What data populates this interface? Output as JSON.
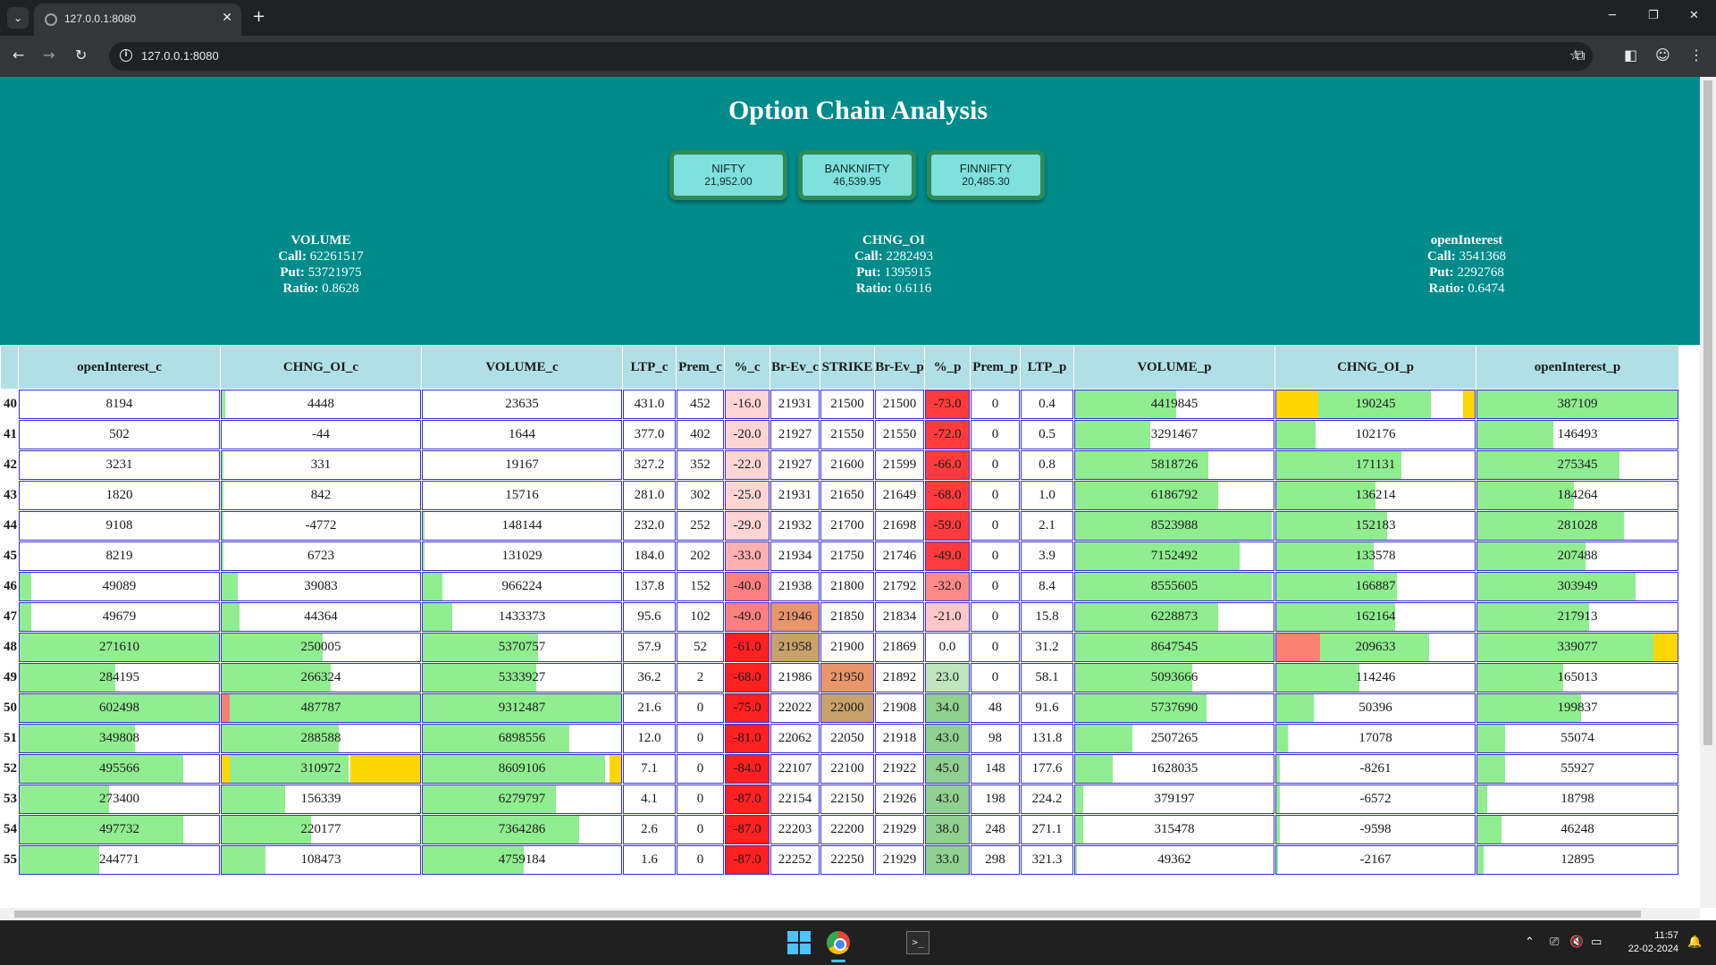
{
  "browser": {
    "tab_title": "127.0.0.1:8080",
    "url": "127.0.0.1:8080",
    "new_tab": "+",
    "close": "✕"
  },
  "page": {
    "title": "Option Chain Analysis",
    "indices": [
      {
        "name": "NIFTY",
        "price": "21,952.00"
      },
      {
        "name": "BANKNIFTY",
        "price": "46,539.95"
      },
      {
        "name": "FINNIFTY",
        "price": "20,485.30"
      }
    ],
    "stats": [
      {
        "heading": "VOLUME",
        "call_label": "Call:",
        "call": "62261517",
        "put_label": "Put:",
        "put": "53721975",
        "ratio_label": "Ratio:",
        "ratio": "0.8628"
      },
      {
        "heading": "CHNG_OI",
        "call_label": "Call:",
        "call": "2282493",
        "put_label": "Put:",
        "put": "1395915",
        "ratio_label": "Ratio:",
        "ratio": "0.6116"
      },
      {
        "heading": "openInterest",
        "call_label": "Call:",
        "call": "3541368",
        "put_label": "Put:",
        "put": "2292768",
        "ratio_label": "Ratio:",
        "ratio": "0.6474"
      }
    ]
  },
  "table": {
    "columns": [
      "openInterest_c",
      "CHNG_OI_c",
      "VOLUME_c",
      "LTP_c",
      "Prem_c",
      "%_c",
      "Br-Ev_c",
      "STRIKE",
      "Br-Ev_p",
      "%_p",
      "Prem_p",
      "LTP_p",
      "VOLUME_p",
      "CHNG_OI_p",
      "openInterest_p"
    ],
    "rows": [
      {
        "n": "40",
        "oi_c": "8194",
        "chg_c": "4448",
        "vol_c": "23635",
        "ltp_c": "431.0",
        "prem_c": "452",
        "pct_c": "-16.0",
        "be_c": "21931",
        "strike": "21500",
        "be_p": "21500",
        "pct_p": "-73.0",
        "prem_p": "0",
        "ltp_p": "0.4",
        "vol_p": "4419845",
        "chg_p": "190245",
        "oi_p": "387109"
      },
      {
        "n": "41",
        "oi_c": "502",
        "chg_c": "-44",
        "vol_c": "1644",
        "ltp_c": "377.0",
        "prem_c": "402",
        "pct_c": "-20.0",
        "be_c": "21927",
        "strike": "21550",
        "be_p": "21550",
        "pct_p": "-72.0",
        "prem_p": "0",
        "ltp_p": "0.5",
        "vol_p": "3291467",
        "chg_p": "102176",
        "oi_p": "146493"
      },
      {
        "n": "42",
        "oi_c": "3231",
        "chg_c": "331",
        "vol_c": "19167",
        "ltp_c": "327.2",
        "prem_c": "352",
        "pct_c": "-22.0",
        "be_c": "21927",
        "strike": "21600",
        "be_p": "21599",
        "pct_p": "-66.0",
        "prem_p": "0",
        "ltp_p": "0.8",
        "vol_p": "5818726",
        "chg_p": "171131",
        "oi_p": "275345"
      },
      {
        "n": "43",
        "oi_c": "1820",
        "chg_c": "842",
        "vol_c": "15716",
        "ltp_c": "281.0",
        "prem_c": "302",
        "pct_c": "-25.0",
        "be_c": "21931",
        "strike": "21650",
        "be_p": "21649",
        "pct_p": "-68.0",
        "prem_p": "0",
        "ltp_p": "1.0",
        "vol_p": "6186792",
        "chg_p": "136214",
        "oi_p": "184264"
      },
      {
        "n": "44",
        "oi_c": "9108",
        "chg_c": "-4772",
        "vol_c": "148144",
        "ltp_c": "232.0",
        "prem_c": "252",
        "pct_c": "-29.0",
        "be_c": "21932",
        "strike": "21700",
        "be_p": "21698",
        "pct_p": "-59.0",
        "prem_p": "0",
        "ltp_p": "2.1",
        "vol_p": "8523988",
        "chg_p": "152183",
        "oi_p": "281028"
      },
      {
        "n": "45",
        "oi_c": "8219",
        "chg_c": "6723",
        "vol_c": "131029",
        "ltp_c": "184.0",
        "prem_c": "202",
        "pct_c": "-33.0",
        "be_c": "21934",
        "strike": "21750",
        "be_p": "21746",
        "pct_p": "-49.0",
        "prem_p": "0",
        "ltp_p": "3.9",
        "vol_p": "7152492",
        "chg_p": "133578",
        "oi_p": "207488"
      },
      {
        "n": "46",
        "oi_c": "49089",
        "chg_c": "39083",
        "vol_c": "966224",
        "ltp_c": "137.8",
        "prem_c": "152",
        "pct_c": "-40.0",
        "be_c": "21938",
        "strike": "21800",
        "be_p": "21792",
        "pct_p": "-32.0",
        "prem_p": "0",
        "ltp_p": "8.4",
        "vol_p": "8555605",
        "chg_p": "166887",
        "oi_p": "303949"
      },
      {
        "n": "47",
        "oi_c": "49679",
        "chg_c": "44364",
        "vol_c": "1433373",
        "ltp_c": "95.6",
        "prem_c": "102",
        "pct_c": "-49.0",
        "be_c": "21946",
        "strike": "21850",
        "be_p": "21834",
        "pct_p": "-21.0",
        "prem_p": "0",
        "ltp_p": "15.8",
        "vol_p": "6228873",
        "chg_p": "162164",
        "oi_p": "217913"
      },
      {
        "n": "48",
        "oi_c": "271610",
        "chg_c": "250005",
        "vol_c": "5370757",
        "ltp_c": "57.9",
        "prem_c": "52",
        "pct_c": "-61.0",
        "be_c": "21958",
        "strike": "21900",
        "be_p": "21869",
        "pct_p": "0.0",
        "prem_p": "0",
        "ltp_p": "31.2",
        "vol_p": "8647545",
        "chg_p": "209633",
        "oi_p": "339077"
      },
      {
        "n": "49",
        "oi_c": "284195",
        "chg_c": "266324",
        "vol_c": "5333927",
        "ltp_c": "36.2",
        "prem_c": "2",
        "pct_c": "-68.0",
        "be_c": "21986",
        "strike": "21950",
        "be_p": "21892",
        "pct_p": "23.0",
        "prem_p": "0",
        "ltp_p": "58.1",
        "vol_p": "5093666",
        "chg_p": "114246",
        "oi_p": "165013"
      },
      {
        "n": "50",
        "oi_c": "602498",
        "chg_c": "487787",
        "vol_c": "9312487",
        "ltp_c": "21.6",
        "prem_c": "0",
        "pct_c": "-75.0",
        "be_c": "22022",
        "strike": "22000",
        "be_p": "21908",
        "pct_p": "34.0",
        "prem_p": "48",
        "ltp_p": "91.6",
        "vol_p": "5737690",
        "chg_p": "50396",
        "oi_p": "199837"
      },
      {
        "n": "51",
        "oi_c": "349808",
        "chg_c": "288588",
        "vol_c": "6898556",
        "ltp_c": "12.0",
        "prem_c": "0",
        "pct_c": "-81.0",
        "be_c": "22062",
        "strike": "22050",
        "be_p": "21918",
        "pct_p": "43.0",
        "prem_p": "98",
        "ltp_p": "131.8",
        "vol_p": "2507265",
        "chg_p": "17078",
        "oi_p": "55074"
      },
      {
        "n": "52",
        "oi_c": "495566",
        "chg_c": "310972",
        "vol_c": "8609106",
        "ltp_c": "7.1",
        "prem_c": "0",
        "pct_c": "-84.0",
        "be_c": "22107",
        "strike": "22100",
        "be_p": "21922",
        "pct_p": "45.0",
        "prem_p": "148",
        "ltp_p": "177.6",
        "vol_p": "1628035",
        "chg_p": "-8261",
        "oi_p": "55927"
      },
      {
        "n": "53",
        "oi_c": "273400",
        "chg_c": "156339",
        "vol_c": "6279797",
        "ltp_c": "4.1",
        "prem_c": "0",
        "pct_c": "-87.0",
        "be_c": "22154",
        "strike": "22150",
        "be_p": "21926",
        "pct_p": "43.0",
        "prem_p": "198",
        "ltp_p": "224.2",
        "vol_p": "379197",
        "chg_p": "-6572",
        "oi_p": "18798"
      },
      {
        "n": "54",
        "oi_c": "497732",
        "chg_c": "220177",
        "vol_c": "7364286",
        "ltp_c": "2.6",
        "prem_c": "0",
        "pct_c": "-87.0",
        "be_c": "22203",
        "strike": "22200",
        "be_p": "21929",
        "pct_p": "38.0",
        "prem_p": "248",
        "ltp_p": "271.1",
        "vol_p": "315478",
        "chg_p": "-9598",
        "oi_p": "46248"
      },
      {
        "n": "55",
        "oi_c": "244771",
        "chg_c": "108473",
        "vol_c": "4759184",
        "ltp_c": "1.6",
        "prem_c": "0",
        "pct_c": "-87.0",
        "be_c": "22252",
        "strike": "22250",
        "be_p": "21929",
        "pct_p": "33.0",
        "prem_p": "298",
        "ltp_p": "321.3",
        "vol_p": "49362",
        "chg_p": "-2167",
        "oi_p": "12895"
      }
    ]
  },
  "colors": {
    "hero_bg": "#008b8b",
    "header_bg": "#b0e0e6",
    "bar_green": "#90ee90",
    "bar_gold": "#ffd700",
    "bar_salmon": "#fa8072",
    "cell_border": "#3a2fd1",
    "strike_highlight": "#c8a26a"
  },
  "taskbar": {
    "time": "11:57",
    "date": "22-02-2024"
  }
}
